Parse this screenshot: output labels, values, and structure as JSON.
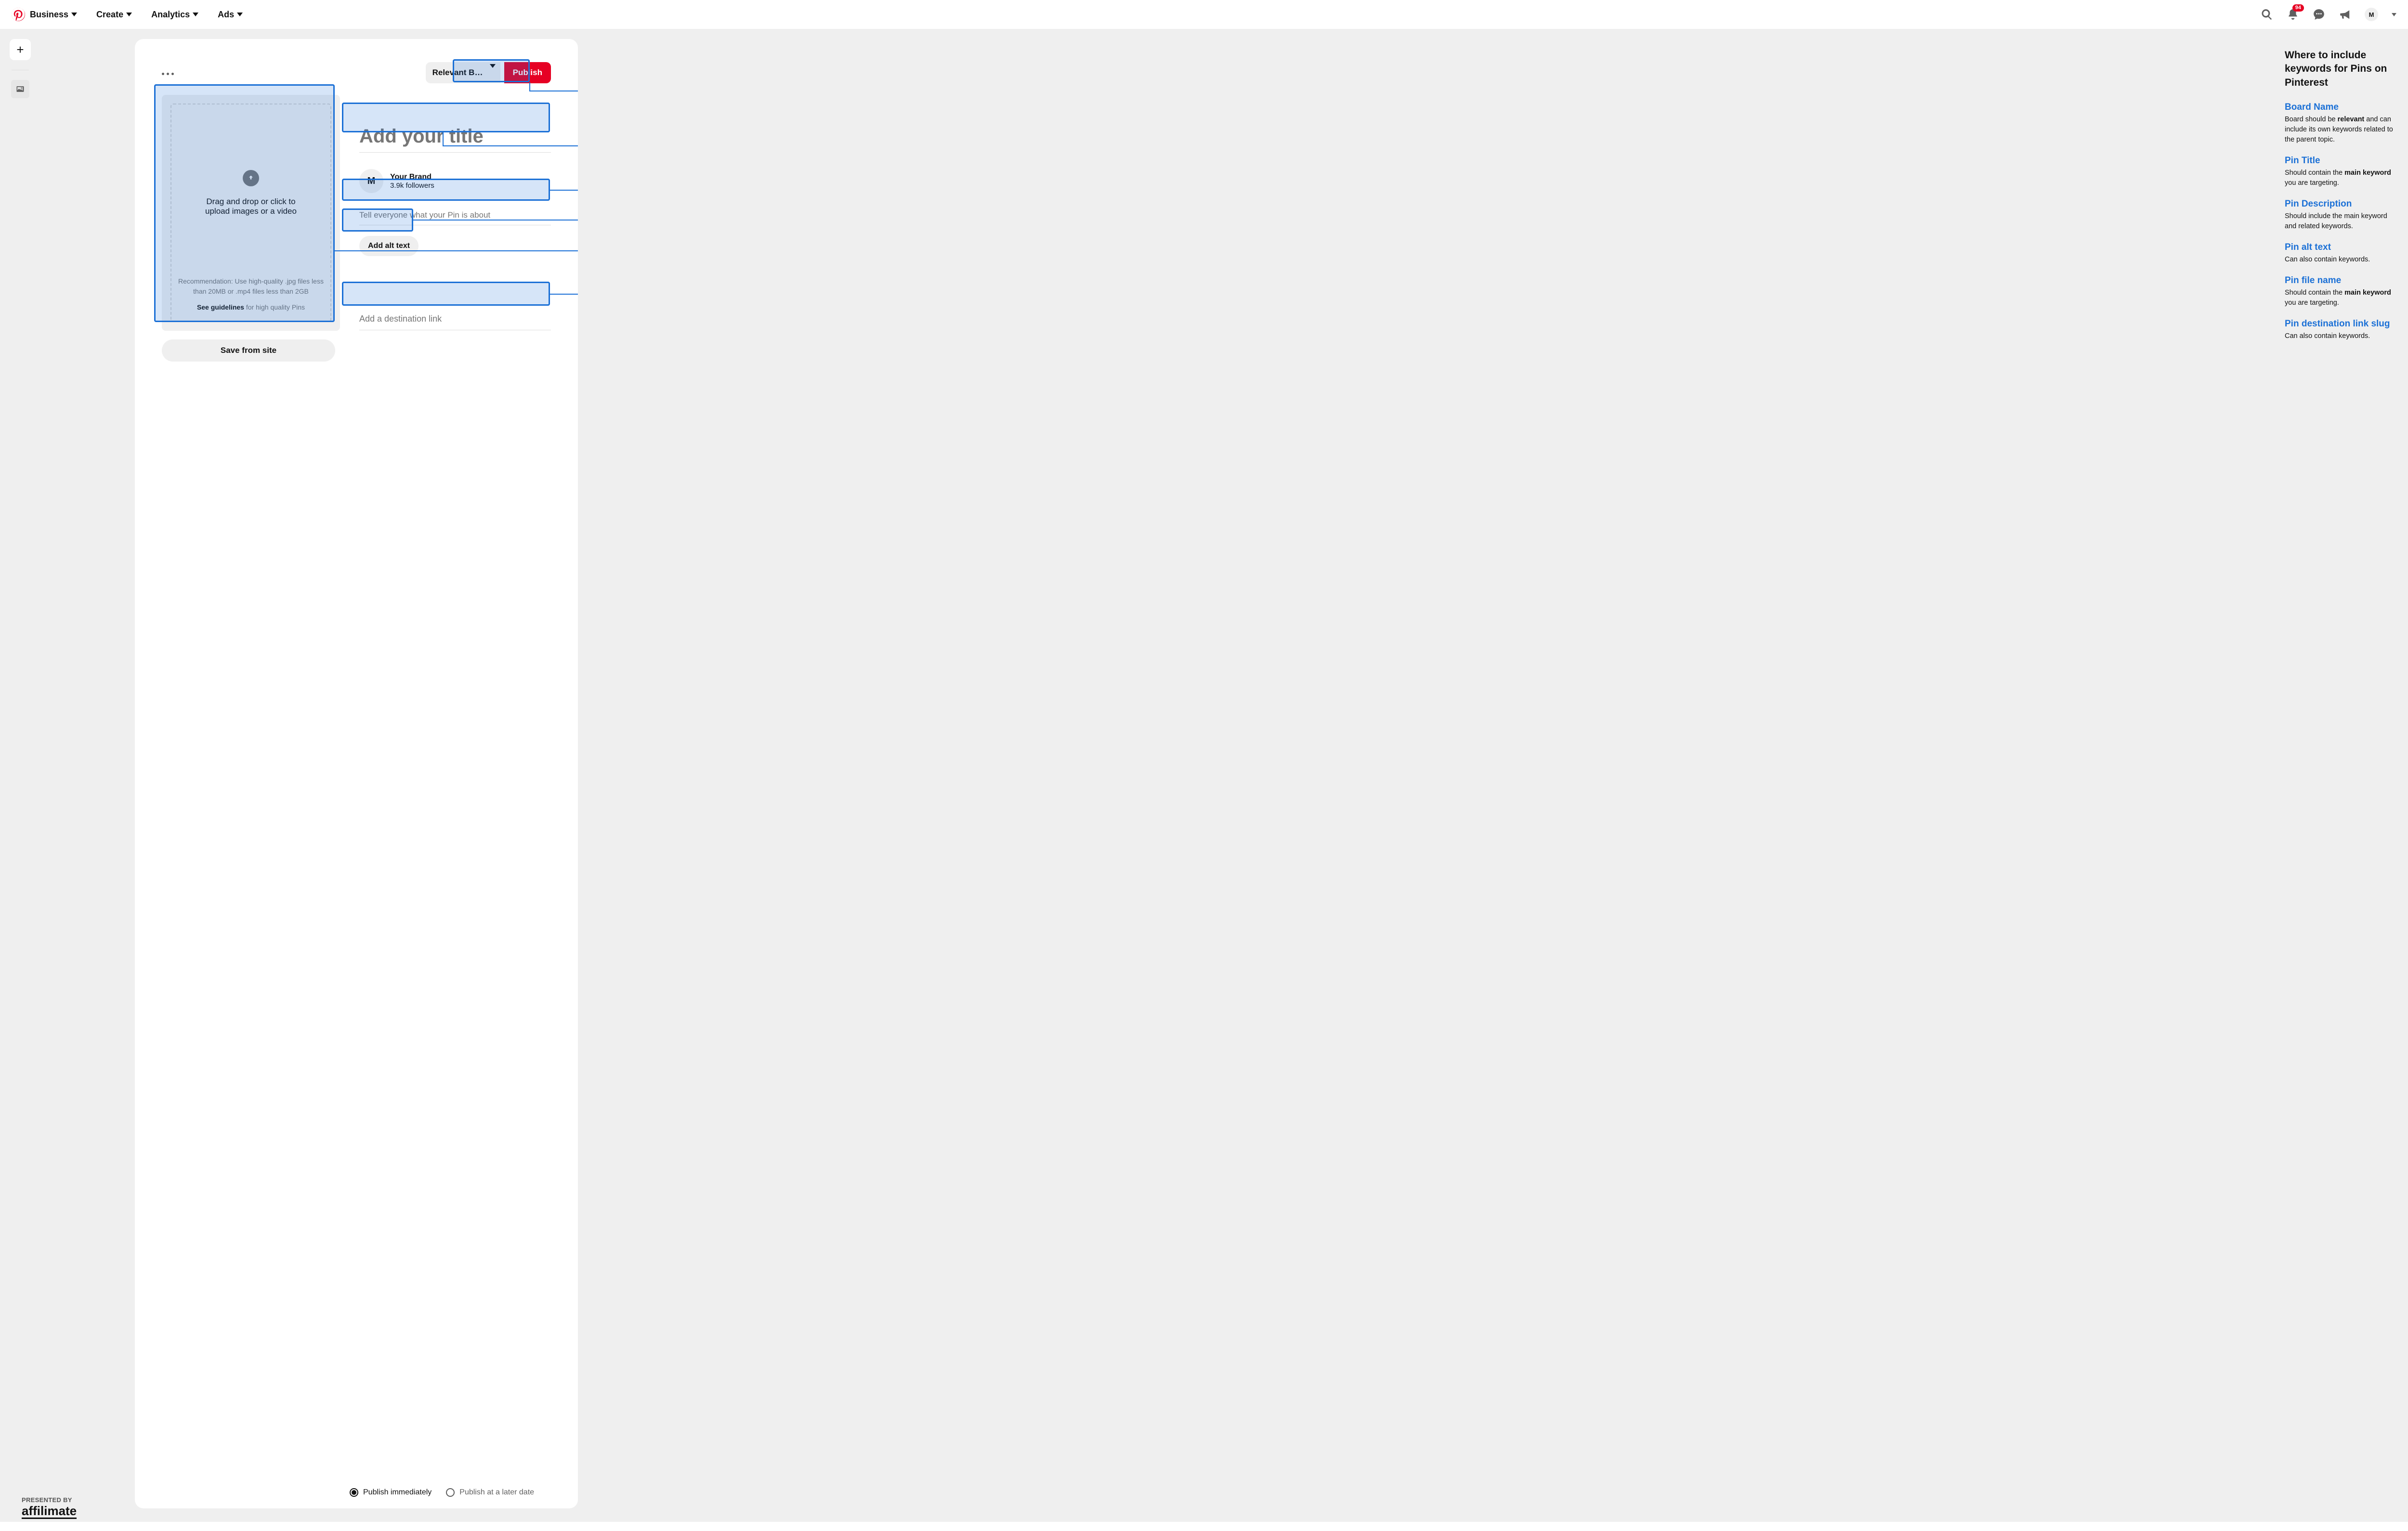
{
  "header": {
    "nav": {
      "business": "Business",
      "create": "Create",
      "analytics": "Analytics",
      "ads": "Ads"
    },
    "notifications_count": "94",
    "avatar_letter": "M"
  },
  "rail": {
    "add_label": "+"
  },
  "card": {
    "board_selector": "Relevant Bo…",
    "publish": "Publish",
    "upload_main": "Drag and drop or click to upload images or a video",
    "upload_recommendation": "Recommendation: Use high-quality .jpg files less than 20MB or .mp4 files less than 2GB",
    "guidelines_strong": "See guidelines",
    "guidelines_tail": " for high quality Pins",
    "save_from_site": "Save from site",
    "title_placeholder": "Add your title",
    "brand_name": "Your Brand",
    "brand_avatar": "M",
    "followers": "3.9k followers",
    "description_placeholder": "Tell everyone what your Pin is about",
    "alt_text": "Add alt text",
    "link_placeholder": "Add a destination link",
    "radio_publish_now": "Publish immediately",
    "radio_publish_later": "Publish at a later date"
  },
  "annotations": {
    "title": "Where to include keywords for Pins on Pinterest",
    "items": {
      "board": {
        "label": "Board Name",
        "pre": "Board should be ",
        "bold": "relevant",
        "post": " and can include its own keywords related to the parent topic."
      },
      "pin_title": {
        "label": "Pin Title",
        "pre": "Should contain the ",
        "bold": "main keyword",
        "post": " you are targeting."
      },
      "pin_desc": {
        "label": "Pin Description",
        "text": "Should include the main keyword and related keywords."
      },
      "pin_alt": {
        "label": "Pin alt text",
        "text": "Can also contain keywords."
      },
      "pin_file": {
        "label": "Pin file name",
        "pre": "Should contain the ",
        "bold": "main keyword",
        "post": " you are targeting."
      },
      "pin_link": {
        "label": "Pin destination link slug",
        "text": "Can also contain keywords."
      }
    }
  },
  "presented": {
    "label": "PRESENTED BY",
    "brand": "affilimate"
  }
}
